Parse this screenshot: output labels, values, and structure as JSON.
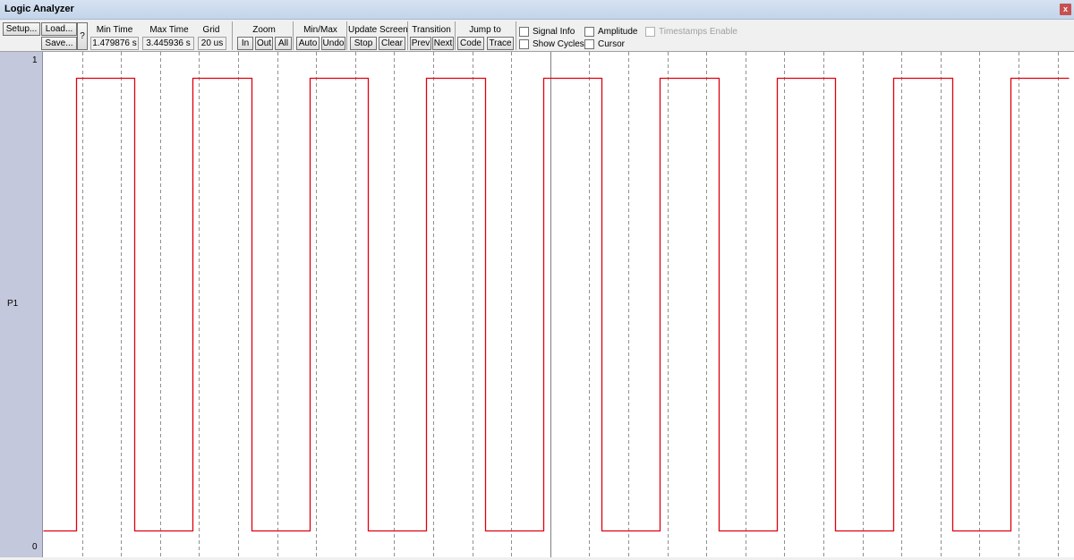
{
  "window": {
    "title": "Logic Analyzer",
    "close_label": "x"
  },
  "toolbar": {
    "setup": "Setup...",
    "load": "Load...",
    "save": "Save...",
    "help": "?",
    "min_time_label": "Min Time",
    "min_time_value": "1.479876 s",
    "max_time_label": "Max Time",
    "max_time_value": "3.445936 s",
    "grid_label": "Grid",
    "grid_value": "20 us",
    "zoom_label": "Zoom",
    "zoom_in": "In",
    "zoom_out": "Out",
    "zoom_all": "All",
    "minmax_label": "Min/Max",
    "minmax_auto": "Auto",
    "minmax_undo": "Undo",
    "update_label": "Update Screen",
    "update_stop": "Stop",
    "update_clear": "Clear",
    "transition_label": "Transition",
    "transition_prev": "Prev",
    "transition_next": "Next",
    "jump_label": "Jump to",
    "jump_code": "Code",
    "jump_trace": "Trace",
    "signal_info": "Signal Info",
    "amplitude": "Amplitude",
    "timestamps_enable": "Timestamps Enable",
    "show_cycles": "Show Cycles",
    "cursor": "Cursor"
  },
  "signal": {
    "name": "P1",
    "high_label": "1",
    "low_label": "0",
    "color": "#e0000f"
  },
  "chart_data": {
    "type": "line",
    "title": "",
    "series": [
      {
        "name": "P1",
        "x": [
          0,
          37,
          37,
          102,
          102,
          167,
          167,
          233,
          233,
          298,
          298,
          363,
          363,
          428,
          428,
          494,
          494,
          559,
          559,
          624,
          624,
          689,
          689,
          755,
          755,
          820,
          820,
          885,
          885,
          950,
          950,
          1016,
          1016,
          1081,
          1081,
          1146
        ],
        "y": [
          0,
          0,
          1,
          1,
          0,
          0,
          1,
          1,
          0,
          0,
          1,
          1,
          0,
          0,
          1,
          1,
          0,
          0,
          1,
          1,
          0,
          0,
          1,
          1,
          0,
          0,
          1,
          1,
          0,
          0,
          1,
          1,
          0,
          0,
          1,
          1
        ]
      }
    ],
    "ylim": [
      0,
      1
    ],
    "ytick_labels": [
      "0",
      "1"
    ],
    "grid": true
  }
}
